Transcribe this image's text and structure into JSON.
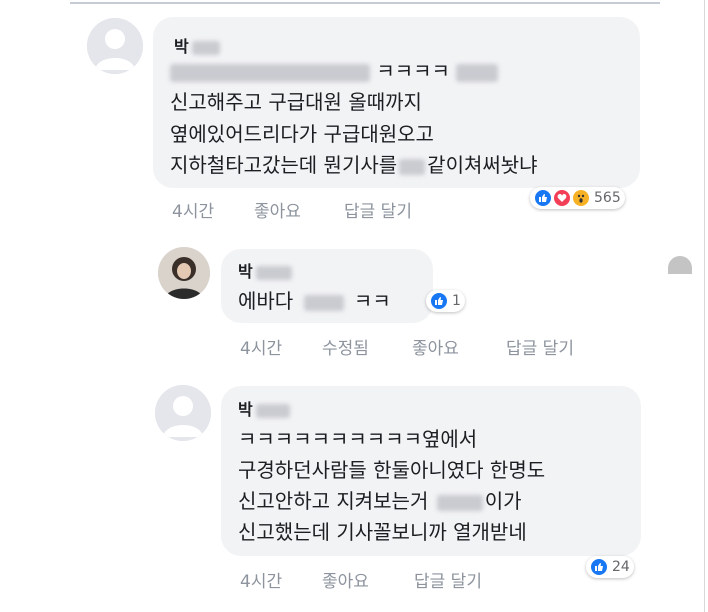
{
  "colors": {
    "bubble": "#f2f3f5",
    "meta_text": "#8d949e",
    "like_blue": "#1877f2",
    "love_red": "#f33e58",
    "wow_yellow": "#f7b125"
  },
  "comments": [
    {
      "name": "박",
      "lines": [
        "ㅋㅋㅋㅋ",
        "신고해주고 구급대원 올때까지",
        "옆에있어드리다가 구급대원오고",
        "지하철타고갔는데 뭔기사를",
        "같이쳐써놧냐"
      ],
      "time": "4시간",
      "like": "좋아요",
      "reply": "답글 달기",
      "reaction_count": "565",
      "reactions": [
        "like-icon",
        "love-icon",
        "wow-icon"
      ]
    },
    {
      "name": "박",
      "lines": [
        "에바다",
        "ㅋㅋ"
      ],
      "time": "4시간",
      "edited": "수정됨",
      "like": "좋아요",
      "reply": "답글 달기",
      "reaction_count": "1",
      "reactions": [
        "like-icon"
      ]
    },
    {
      "name": "박",
      "lines": [
        "ㅋㅋㅋㅋㅋㅋㅋㅋㅋㅋ옆에서",
        "구경하던사람들 한둘아니였다 한명도",
        "신고안하고 지켜보는거",
        "이가",
        "신고했는데 기사꼴보니까 열개받네"
      ],
      "time": "4시간",
      "like": "좋아요",
      "reply": "답글 달기",
      "reaction_count": "24",
      "reactions": [
        "like-icon"
      ]
    }
  ]
}
